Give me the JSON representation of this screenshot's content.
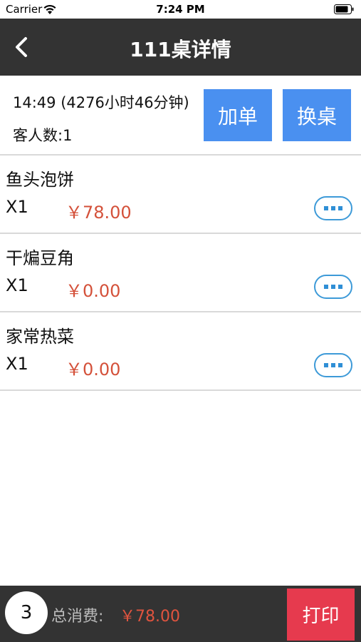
{
  "status_bar": {
    "carrier": "Carrier",
    "time": "7:24 PM",
    "icons": [
      "wifi-icon",
      "battery-icon"
    ]
  },
  "nav": {
    "title": "111桌详情",
    "back_icon": "chevron-left-icon"
  },
  "info": {
    "time_text": "14:49 (4276小时46分钟)",
    "guests_text": "客人数:1",
    "add_order_label": "加单",
    "change_table_label": "换桌",
    "button_color": "#4a90f0"
  },
  "orders": [
    {
      "name": "鱼头泡饼",
      "qty": "X1",
      "price": "￥78.00"
    },
    {
      "name": "干煸豆角",
      "qty": "X1",
      "price": "￥0.00"
    },
    {
      "name": "家常热菜",
      "qty": "X1",
      "price": "￥0.00"
    }
  ],
  "bottom": {
    "count": "3",
    "total_label": "总消费:",
    "total_value": "￥78.00",
    "print_label": "打印",
    "print_color": "#e63a4e"
  },
  "colors": {
    "bar_background": "#333333",
    "price_red": "#d4513a",
    "more_button_blue": "#3d9ad8"
  }
}
